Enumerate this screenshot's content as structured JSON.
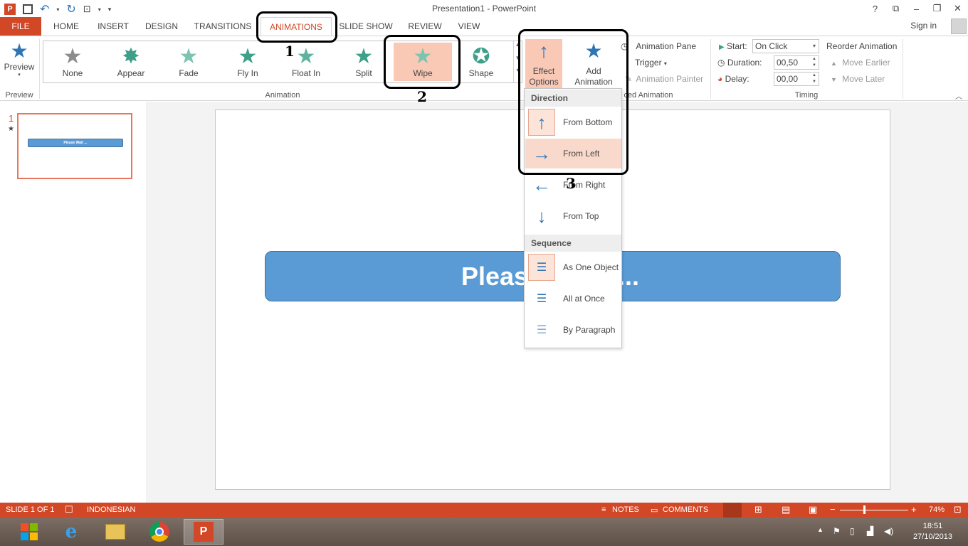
{
  "window": {
    "title": "Presentation1 - PowerPoint"
  },
  "title_controls": {
    "help": "?",
    "ribbon_display": "⧉",
    "minimize": "–",
    "maximize": "❐",
    "close": "✕"
  },
  "tabs": [
    "FILE",
    "HOME",
    "INSERT",
    "DESIGN",
    "TRANSITIONS",
    "ANIMATIONS",
    "SLIDE SHOW",
    "REVIEW",
    "VIEW"
  ],
  "account": {
    "signin": "Sign in"
  },
  "ribbon": {
    "preview": {
      "label": "Preview",
      "group": "Preview"
    },
    "animation_group": "Animation",
    "gallery": [
      {
        "label": "None",
        "color": "#8c8c8c"
      },
      {
        "label": "Appear",
        "color": "#3fa08a"
      },
      {
        "label": "Fade",
        "color": "#7dc4b0"
      },
      {
        "label": "Fly In",
        "color": "#3fa08a"
      },
      {
        "label": "Float In",
        "color": "#5fb39e"
      },
      {
        "label": "Split",
        "color": "#3fa08a"
      },
      {
        "label": "Wipe",
        "color": "#7dc4b0"
      },
      {
        "label": "Shape",
        "color": "#3fa08a"
      }
    ],
    "effect_options": {
      "line1": "Effect",
      "line2": "Options"
    },
    "add_animation": {
      "line1": "Add",
      "line2": "Animation"
    },
    "advanced": {
      "animation_pane": "Animation Pane",
      "trigger": "Trigger",
      "animation_painter": "Animation Painter",
      "group": "ced Animation"
    },
    "timing": {
      "start_label": "Start:",
      "start_value": "On Click",
      "duration_label": "Duration:",
      "duration_value": "00,50",
      "delay_label": "Delay:",
      "delay_value": "00,00",
      "reorder": "Reorder Animation",
      "move_earlier": "Move Earlier",
      "move_later": "Move Later",
      "group": "Timing"
    }
  },
  "annotations": {
    "n1": "1",
    "n2": "2",
    "n3": "3"
  },
  "thumbnail": {
    "number": "1",
    "star": "★",
    "text": "Please Wait ..."
  },
  "slide": {
    "text_left": "Pleas",
    "text_right": "..."
  },
  "dropdown": {
    "direction_header": "Direction",
    "sequence_header": "Sequence",
    "direction_items": [
      "From Bottom",
      "From Left",
      "From Right",
      "From Top"
    ],
    "sequence_items": [
      "As One Object",
      "All at Once",
      "By Paragraph"
    ]
  },
  "status": {
    "slide": "SLIDE 1 OF 1",
    "language": "INDONESIAN",
    "notes": "NOTES",
    "comments": "COMMENTS",
    "zoom": "74%"
  },
  "taskbar": {
    "time": "18:51",
    "date": "27/10/2013"
  },
  "colors": {
    "accent": "#d24726",
    "selected": "#f9c9b6",
    "shape": "#5b9bd5"
  }
}
